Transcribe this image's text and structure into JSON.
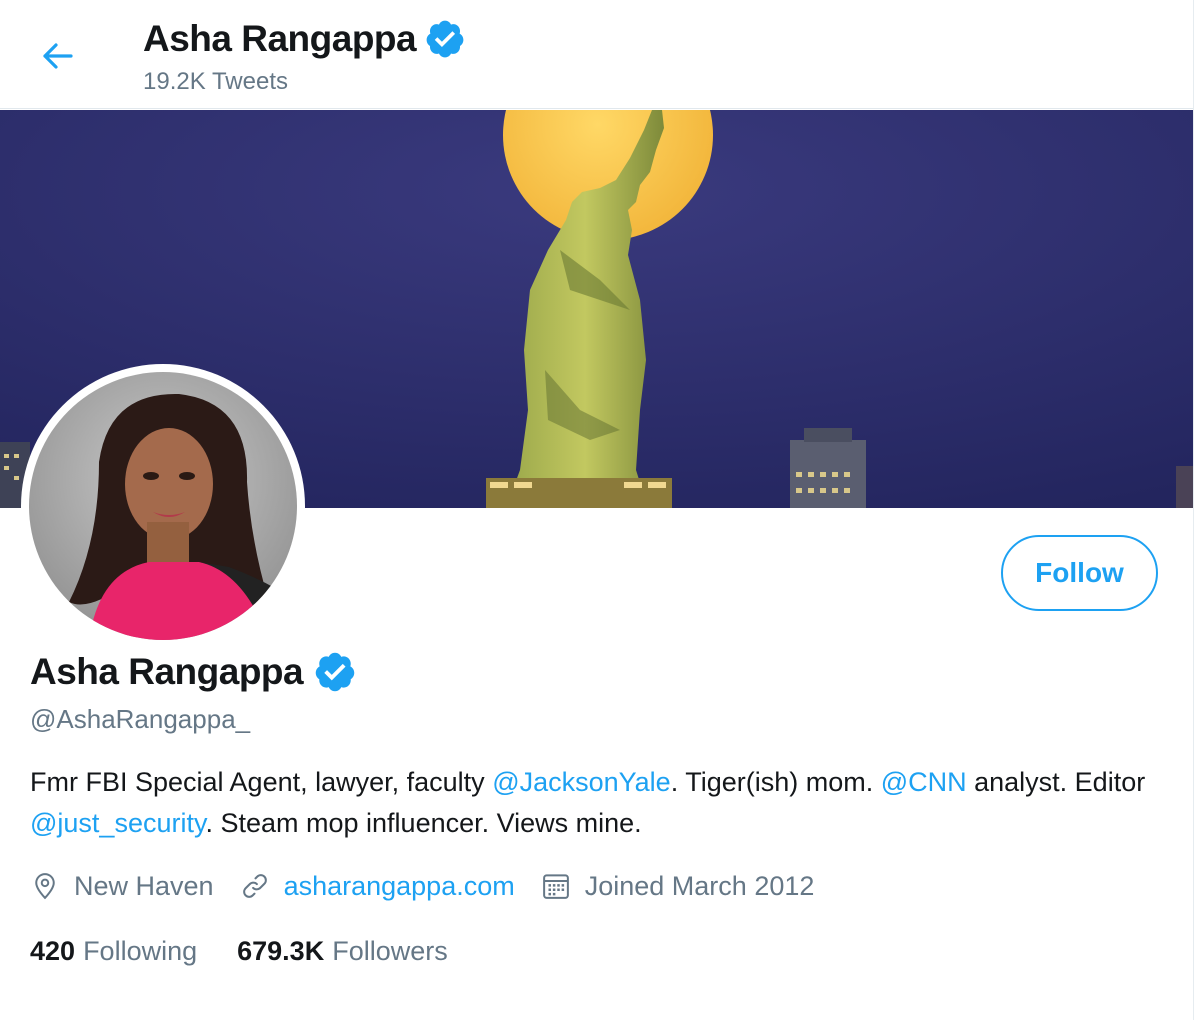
{
  "header": {
    "name": "Asha Rangappa",
    "tweets_count": "19.2K Tweets"
  },
  "icons": {
    "back": "arrow-left-icon",
    "verified": "verified-badge-icon",
    "location": "location-pin-icon",
    "link": "link-icon",
    "calendar": "calendar-icon"
  },
  "colors": {
    "accent": "#1da1f2",
    "text": "#14171a",
    "muted": "#657786"
  },
  "profile": {
    "display_name": "Asha Rangappa",
    "handle": "@AshaRangappa_",
    "follow_label": "Follow",
    "bio": {
      "t1": "Fmr FBI Special Agent, lawyer, faculty ",
      "m1": "@JacksonYale",
      "t2": ". Tiger(ish) mom. ",
      "m2": "@CNN",
      "t3": " analyst. Editor ",
      "m3": "@just_security",
      "t4": ". Steam mop influencer. Views mine."
    },
    "location": "New Haven",
    "website": "asharangappa.com",
    "joined": "Joined March 2012",
    "following_count": "420",
    "following_label": "Following",
    "followers_count": "679.3K",
    "followers_label": "Followers"
  }
}
